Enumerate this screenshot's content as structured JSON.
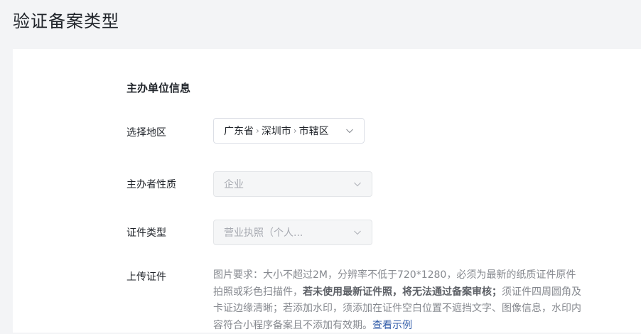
{
  "page": {
    "title": "验证备案类型"
  },
  "form": {
    "section_title": "主办单位信息",
    "region": {
      "label": "选择地区",
      "province": "广东省",
      "city": "深圳市",
      "district": "市辖区"
    },
    "organizer_nature": {
      "label": "主办者性质",
      "value": "企业"
    },
    "certificate_type": {
      "label": "证件类型",
      "value": "营业执照（个人..."
    },
    "upload": {
      "label": "上传证件",
      "requirement_part1": "图片要求：大小不超过2M，分辨率不低于720*1280，必须为最新的纸质证件原件拍照或彩色扫描件，",
      "requirement_bold": "若未使用最新证件照，将无法通过备案审核；",
      "requirement_part2": "须证件四周圆角及卡证边缘清晰；若添加水印，须添加在证件空白位置不遮挡文字、图像信息，水印内容符合小程序备案且不添加有效期。",
      "example_link": "查看示例"
    }
  }
}
